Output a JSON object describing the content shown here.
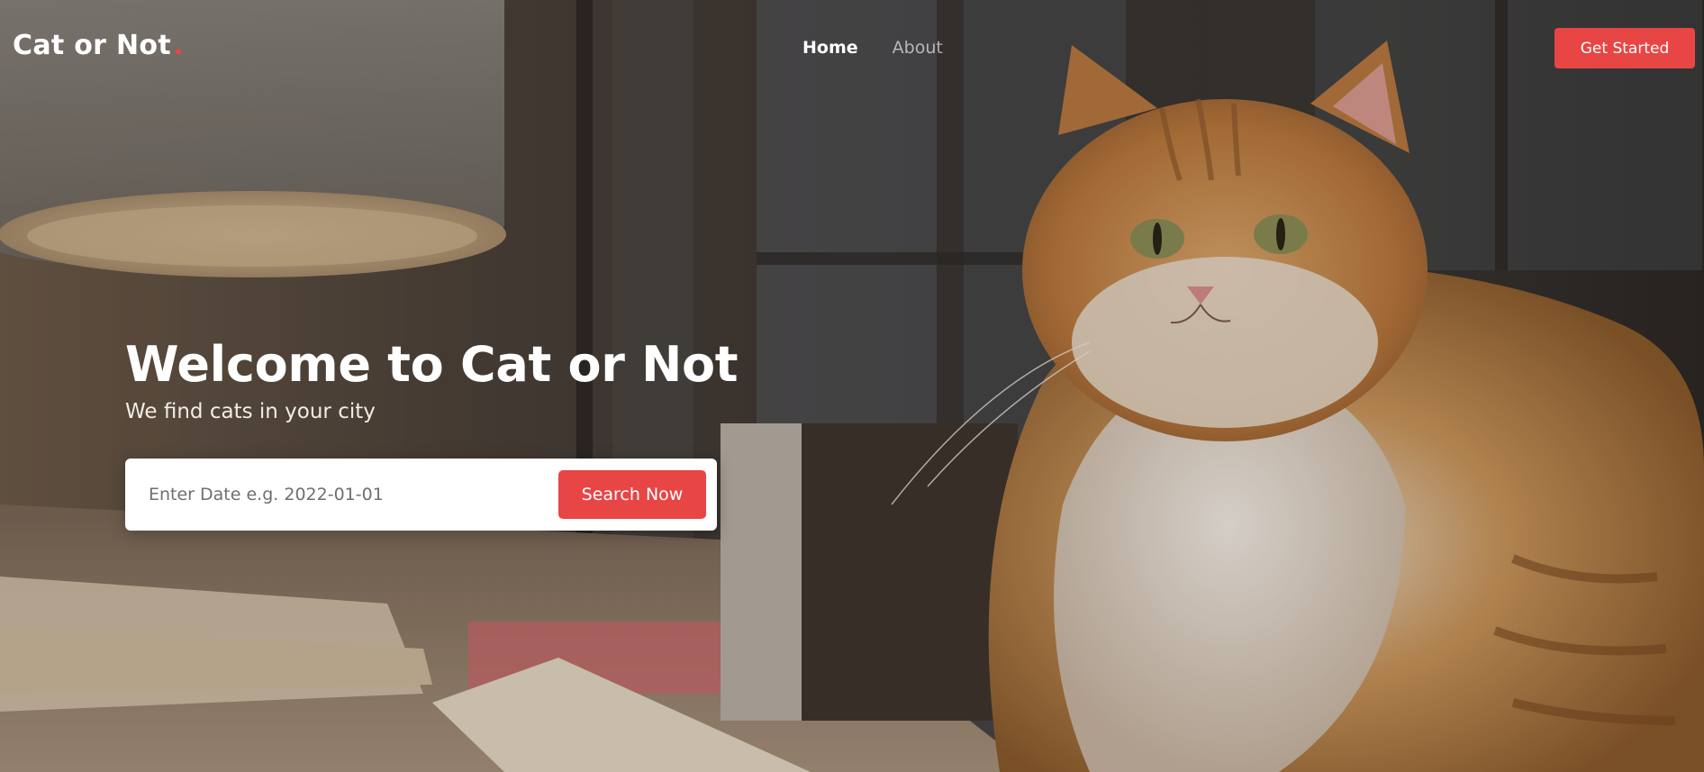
{
  "brand": {
    "name": "Cat or Not",
    "dot": ".",
    "accent_color": "#e84545"
  },
  "nav": {
    "items": [
      {
        "label": "Home",
        "state": "active"
      },
      {
        "label": "About",
        "state": "inactive"
      }
    ],
    "cta_label": "Get Started"
  },
  "hero": {
    "title": "Welcome to Cat or Not",
    "subtitle": "We find cats in your city",
    "background": "photo of a fluffy orange-and-white cat sitting beside a desk lamp and books",
    "search": {
      "placeholder": "Enter Date e.g. 2022-01-01",
      "value": "",
      "button_label": "Search Now"
    }
  }
}
